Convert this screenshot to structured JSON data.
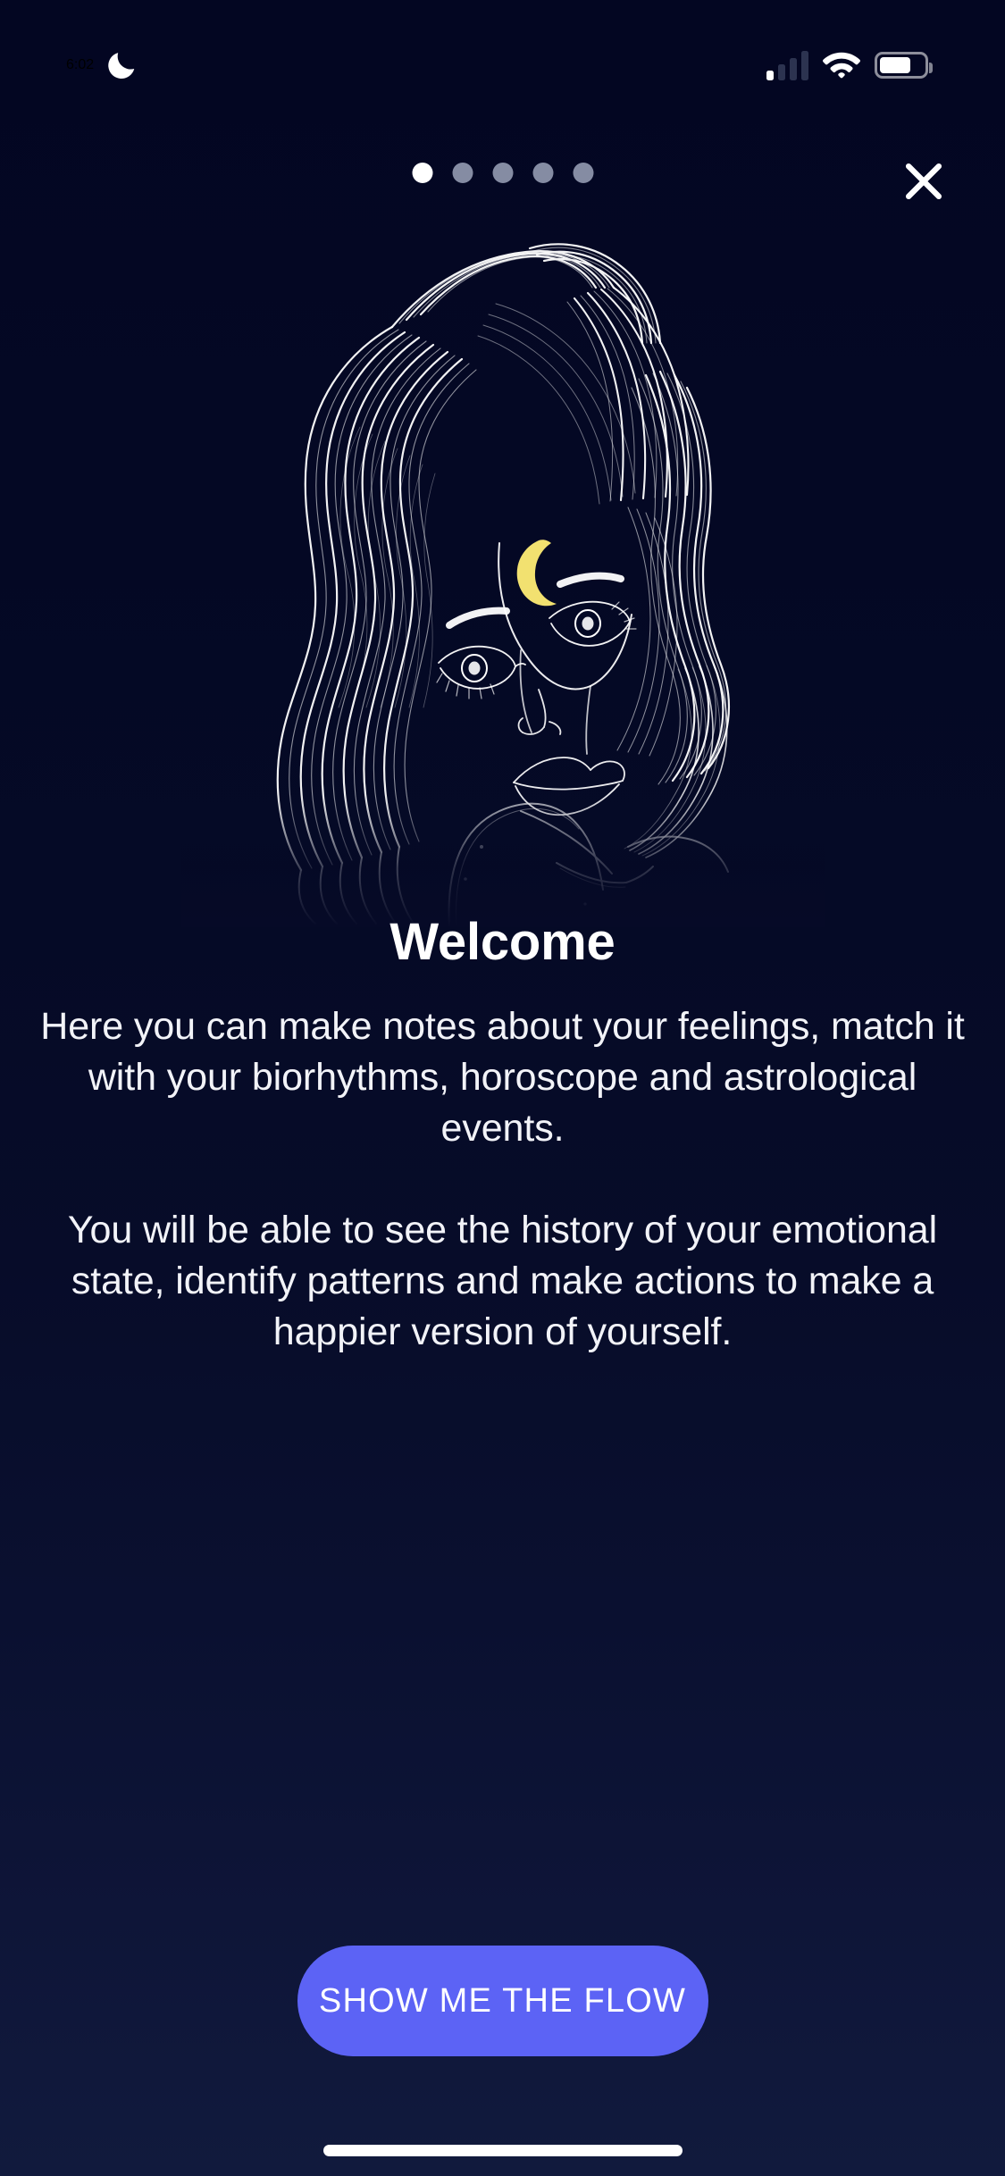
{
  "status_bar": {
    "time": "6:02",
    "dnd_icon": "crescent-moon-icon",
    "cellular_icon": "cellular-signal-icon",
    "cellular_bars_total": 4,
    "cellular_bars_active": 1,
    "wifi_icon": "wifi-icon",
    "battery_icon": "battery-icon",
    "battery_level_percent": 70
  },
  "top_nav": {
    "pager": {
      "total": 5,
      "active_index": 0,
      "active_color": "#FFFFFF",
      "inactive_color": "#858CA3"
    },
    "close_icon": "close-x-icon",
    "close_label": "Close"
  },
  "illustration": {
    "name": "woman-with-crescent-moon-line-art",
    "description": "Line-art portrait of a woman with long flowing wavy hair, looking upward, with a crescent moon on her forehead",
    "line_color": "#FFFFFF",
    "moon_color": "#F2E170"
  },
  "main": {
    "title": "Welcome",
    "paragraphs": [
      "Here you can make notes about your feelings, match it with your biorhythms, horoscope and astrological events.",
      "You will be able to see the history of your emotional state, identify patterns and make actions to make a happier version of yourself."
    ]
  },
  "cta": {
    "label": "SHOW ME THE FLOW",
    "background_color": "#5C63F5",
    "text_color": "#FFFFFF"
  },
  "theme": {
    "background_top": "#030622",
    "background_bottom": "#111A3D",
    "accent": "#5C63F5",
    "text_primary": "#FFFFFF",
    "moon_yellow": "#F2E170"
  }
}
